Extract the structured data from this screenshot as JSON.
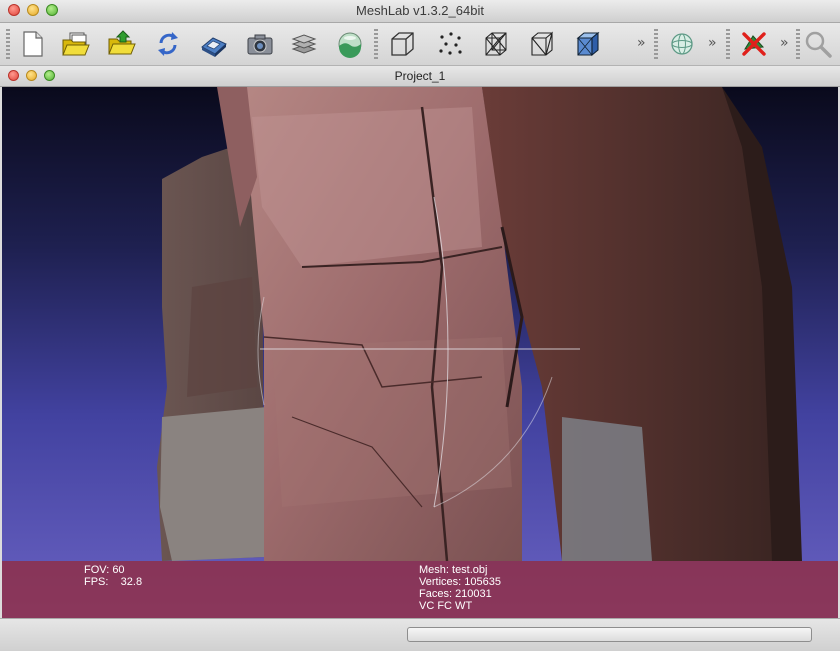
{
  "window": {
    "title": "MeshLab v1.3.2_64bit"
  },
  "toolbar": {
    "buttons": [
      {
        "name": "new-project-icon"
      },
      {
        "name": "open-project-icon"
      },
      {
        "name": "import-mesh-icon"
      },
      {
        "name": "reload-icon"
      },
      {
        "name": "save-icon"
      },
      {
        "name": "snapshot-icon"
      },
      {
        "name": "layers-icon"
      },
      {
        "name": "raster-icon"
      },
      {
        "name": "box-render-icon"
      },
      {
        "name": "points-render-icon"
      },
      {
        "name": "wireframe-render-icon"
      },
      {
        "name": "hidden-lines-render-icon"
      },
      {
        "name": "flat-render-icon"
      },
      {
        "name": "trackball-icon"
      },
      {
        "name": "delete-selection-icon"
      },
      {
        "name": "search-icon"
      }
    ],
    "overflow": "»"
  },
  "document": {
    "title": "Project_1"
  },
  "info": {
    "left": [
      "FOV: 60",
      "FPS:    32.8"
    ],
    "right": [
      "Mesh: test.obj",
      "Vertices: 105635",
      "Faces: 210031",
      "VC FC WT"
    ]
  },
  "status": {
    "progress_fraction": 0.0
  }
}
